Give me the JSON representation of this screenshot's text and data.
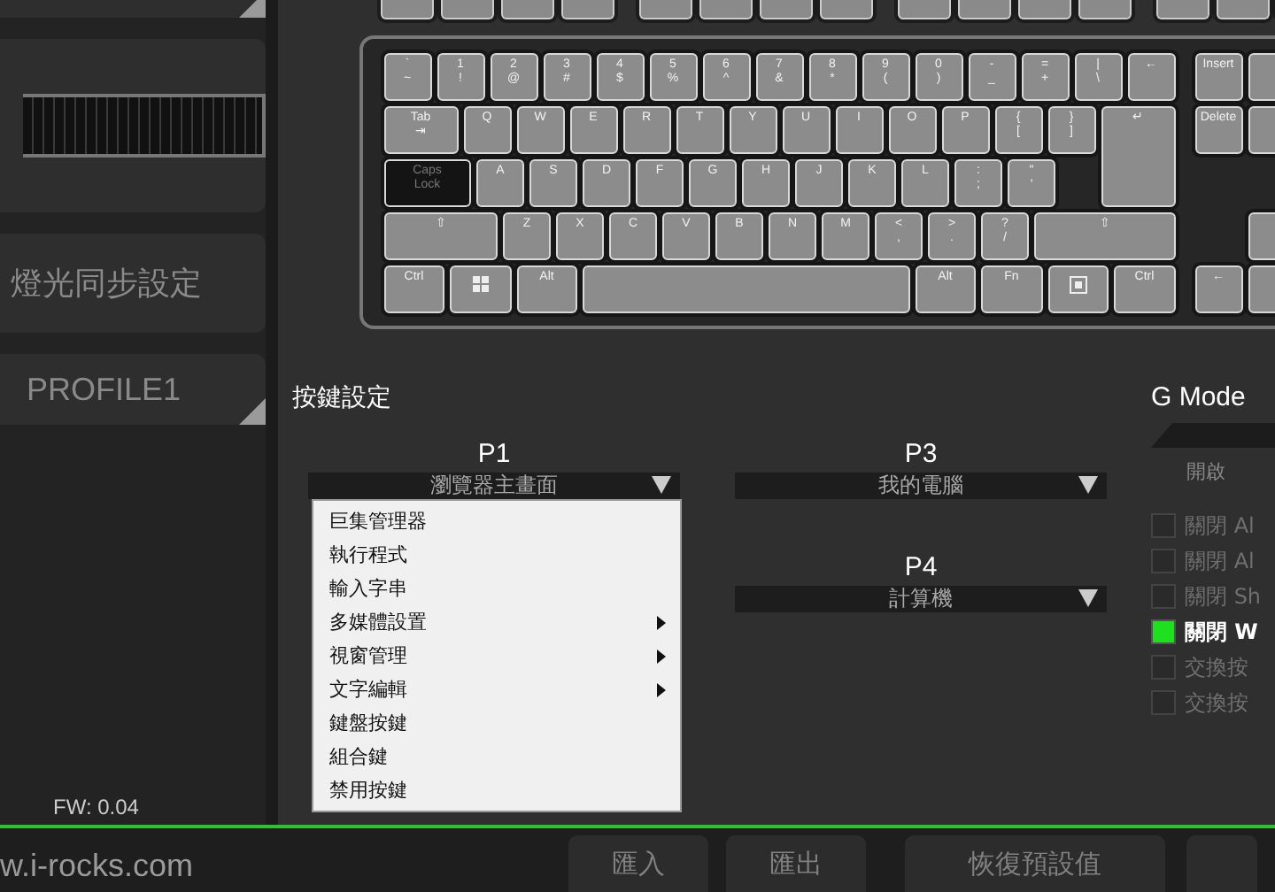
{
  "sidebar": {
    "items": [
      {
        "kind": "blank"
      },
      {
        "kind": "image"
      },
      {
        "kind": "button",
        "label": "燈光同步設定"
      },
      {
        "kind": "profile",
        "label": "PROFILE1"
      }
    ],
    "firmware": "FW: 0.04"
  },
  "keyboard": {
    "rows": [
      {
        "keys": [
          {
            "kind": "key",
            "legend": [
              "`",
              "~"
            ]
          },
          {
            "kind": "key",
            "legend": [
              "1",
              "!"
            ]
          },
          {
            "kind": "key",
            "legend": [
              "2",
              "@"
            ]
          },
          {
            "kind": "key",
            "legend": [
              "3",
              "#"
            ]
          },
          {
            "kind": "key",
            "legend": [
              "4",
              "$"
            ]
          },
          {
            "kind": "key",
            "legend": [
              "5",
              "%"
            ]
          },
          {
            "kind": "key",
            "legend": [
              "6",
              "^"
            ]
          },
          {
            "kind": "key",
            "legend": [
              "7",
              "&"
            ]
          },
          {
            "kind": "key",
            "legend": [
              "8",
              "*"
            ]
          },
          {
            "kind": "key",
            "legend": [
              "9",
              "("
            ]
          },
          {
            "kind": "key",
            "legend": [
              "0",
              ")"
            ]
          },
          {
            "kind": "key",
            "legend": [
              "-",
              "_"
            ]
          },
          {
            "kind": "key",
            "legend": [
              "=",
              "+"
            ]
          },
          {
            "kind": "key",
            "legend": [
              "|",
              "\\"
            ]
          },
          {
            "kind": "key",
            "legend": [
              "←"
            ]
          }
        ]
      },
      {
        "keys": [
          {
            "kind": "key",
            "legend": [
              "Tab",
              "⇥"
            ]
          },
          {
            "kind": "key",
            "legend": [
              "Q"
            ]
          },
          {
            "kind": "key",
            "legend": [
              "W"
            ]
          },
          {
            "kind": "key",
            "legend": [
              "E"
            ]
          },
          {
            "kind": "key",
            "legend": [
              "R"
            ]
          },
          {
            "kind": "key",
            "legend": [
              "T"
            ]
          },
          {
            "kind": "key",
            "legend": [
              "Y"
            ]
          },
          {
            "kind": "key",
            "legend": [
              "U"
            ]
          },
          {
            "kind": "key",
            "legend": [
              "I"
            ]
          },
          {
            "kind": "key",
            "legend": [
              "O"
            ]
          },
          {
            "kind": "key",
            "legend": [
              "P"
            ]
          },
          {
            "kind": "key",
            "legend": [
              "{",
              "["
            ]
          },
          {
            "kind": "key",
            "legend": [
              "}",
              "]"
            ]
          },
          {
            "kind": "key",
            "legend": [
              "↵"
            ]
          }
        ]
      },
      {
        "keys": [
          {
            "kind": "dark",
            "legend": [
              "Caps",
              "Lock"
            ]
          },
          {
            "kind": "key",
            "legend": [
              "A"
            ]
          },
          {
            "kind": "key",
            "legend": [
              "S"
            ]
          },
          {
            "kind": "key",
            "legend": [
              "D"
            ]
          },
          {
            "kind": "key",
            "legend": [
              "F"
            ]
          },
          {
            "kind": "key",
            "legend": [
              "G"
            ]
          },
          {
            "kind": "key",
            "legend": [
              "H"
            ]
          },
          {
            "kind": "key",
            "legend": [
              "J"
            ]
          },
          {
            "kind": "key",
            "legend": [
              "K"
            ]
          },
          {
            "kind": "key",
            "legend": [
              "L"
            ]
          },
          {
            "kind": "key",
            "legend": [
              ":",
              ";"
            ]
          },
          {
            "kind": "key",
            "legend": [
              "\"",
              "'"
            ]
          }
        ]
      },
      {
        "keys": [
          {
            "kind": "key",
            "legend": [
              "⇧"
            ]
          },
          {
            "kind": "key",
            "legend": [
              "Z"
            ]
          },
          {
            "kind": "key",
            "legend": [
              "X"
            ]
          },
          {
            "kind": "key",
            "legend": [
              "C"
            ]
          },
          {
            "kind": "key",
            "legend": [
              "V"
            ]
          },
          {
            "kind": "key",
            "legend": [
              "B"
            ]
          },
          {
            "kind": "key",
            "legend": [
              "N"
            ]
          },
          {
            "kind": "key",
            "legend": [
              "M"
            ]
          },
          {
            "kind": "key",
            "legend": [
              "<",
              ","
            ]
          },
          {
            "kind": "key",
            "legend": [
              ">",
              "."
            ]
          },
          {
            "kind": "key",
            "legend": [
              "?",
              "/"
            ]
          },
          {
            "kind": "key",
            "legend": [
              "⇧"
            ]
          }
        ]
      },
      {
        "keys": [
          {
            "kind": "key",
            "legend": [
              "Ctrl"
            ]
          },
          {
            "kind": "win"
          },
          {
            "kind": "key",
            "legend": [
              "Alt"
            ]
          },
          {
            "kind": "space"
          },
          {
            "kind": "key",
            "legend": [
              "Alt"
            ]
          },
          {
            "kind": "key",
            "legend": [
              "Fn"
            ]
          },
          {
            "kind": "menu"
          },
          {
            "kind": "key",
            "legend": [
              "Ctrl"
            ]
          }
        ]
      }
    ],
    "nav_keys": [
      {
        "legend": [
          "Insert"
        ]
      },
      {
        "legend": [
          "Delete"
        ]
      },
      {
        "legend": [
          "←"
        ]
      }
    ]
  },
  "key_settings": {
    "title": "按鍵設定",
    "slots": [
      {
        "label": "P1",
        "value": "瀏覽器主畫面",
        "open": true
      },
      {
        "label": "P3",
        "value": "我的電腦",
        "open": false
      },
      {
        "label": "P4",
        "value": "計算機",
        "open": false
      }
    ],
    "menu": [
      {
        "label": "巨集管理器",
        "submenu": false
      },
      {
        "label": "執行程式",
        "submenu": false
      },
      {
        "label": "輸入字串",
        "submenu": false
      },
      {
        "label": "多媒體設置",
        "submenu": true
      },
      {
        "label": "視窗管理",
        "submenu": true
      },
      {
        "label": "文字編輯",
        "submenu": true
      },
      {
        "label": "鍵盤按鍵",
        "submenu": false
      },
      {
        "label": "組合鍵",
        "submenu": false
      },
      {
        "label": "禁用按鍵",
        "submenu": false
      }
    ]
  },
  "g_mode": {
    "title": "G Mode",
    "state_label": "開啟",
    "options": [
      {
        "label": "關閉 Al",
        "checked": false
      },
      {
        "label": "關閉 Al",
        "checked": false
      },
      {
        "label": "關閉 Sh",
        "checked": false
      },
      {
        "label": "關閉 W",
        "checked": true
      },
      {
        "label": "交換按",
        "checked": false
      },
      {
        "label": "交換按",
        "checked": false
      }
    ]
  },
  "footer": {
    "site": "w.i-rocks.com",
    "buttons": [
      "匯入",
      "匯出",
      "恢復預設值"
    ]
  }
}
